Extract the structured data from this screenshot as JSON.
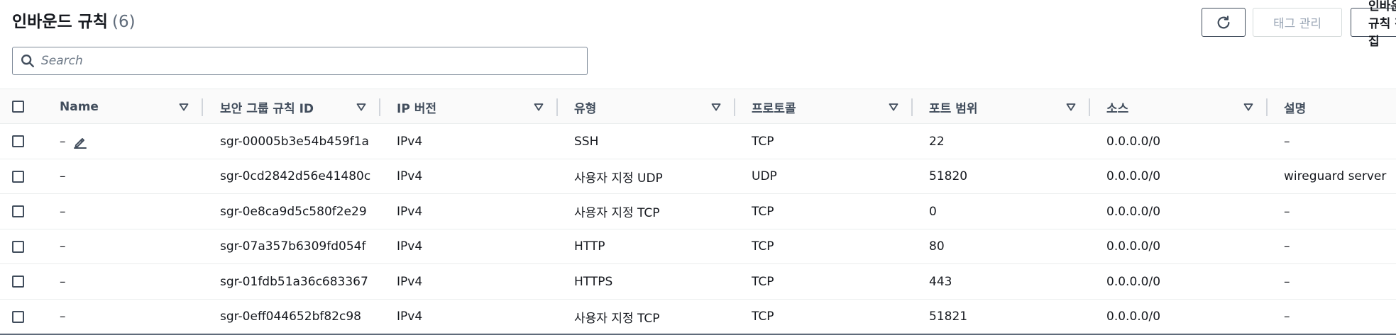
{
  "header": {
    "title": "인바운드 규칙",
    "count": "(6)",
    "manage_tags_label": "태그 관리",
    "edit_label": "인바운드 규칙 편집"
  },
  "search": {
    "placeholder": "Search",
    "value": ""
  },
  "table": {
    "columns": [
      "Name",
      "보안 그룹 규칙 ID",
      "IP 버전",
      "유형",
      "프로토콜",
      "포트 범위",
      "소스",
      "설명"
    ],
    "rows": [
      {
        "name": "–",
        "rule_id": "sgr-00005b3e54b459f1a",
        "ip_version": "IPv4",
        "type": "SSH",
        "protocol": "TCP",
        "port_range": "22",
        "source": "0.0.0.0/0",
        "description": "–"
      },
      {
        "name": "–",
        "rule_id": "sgr-0cd2842d56e41480c",
        "ip_version": "IPv4",
        "type": "사용자 지정 UDP",
        "protocol": "UDP",
        "port_range": "51820",
        "source": "0.0.0.0/0",
        "description": "wireguard server"
      },
      {
        "name": "–",
        "rule_id": "sgr-0e8ca9d5c580f2e29",
        "ip_version": "IPv4",
        "type": "사용자 지정 TCP",
        "protocol": "TCP",
        "port_range": "0",
        "source": "0.0.0.0/0",
        "description": "–"
      },
      {
        "name": "–",
        "rule_id": "sgr-07a357b6309fd054f",
        "ip_version": "IPv4",
        "type": "HTTP",
        "protocol": "TCP",
        "port_range": "80",
        "source": "0.0.0.0/0",
        "description": "–"
      },
      {
        "name": "–",
        "rule_id": "sgr-01fdb51a36c683367",
        "ip_version": "IPv4",
        "type": "HTTPS",
        "protocol": "TCP",
        "port_range": "443",
        "source": "0.0.0.0/0",
        "description": "–"
      },
      {
        "name": "–",
        "rule_id": "sgr-0eff044652bf82c98",
        "ip_version": "IPv4",
        "type": "사용자 지정 TCP",
        "protocol": "TCP",
        "port_range": "51821",
        "source": "0.0.0.0/0",
        "description": "–"
      }
    ]
  }
}
